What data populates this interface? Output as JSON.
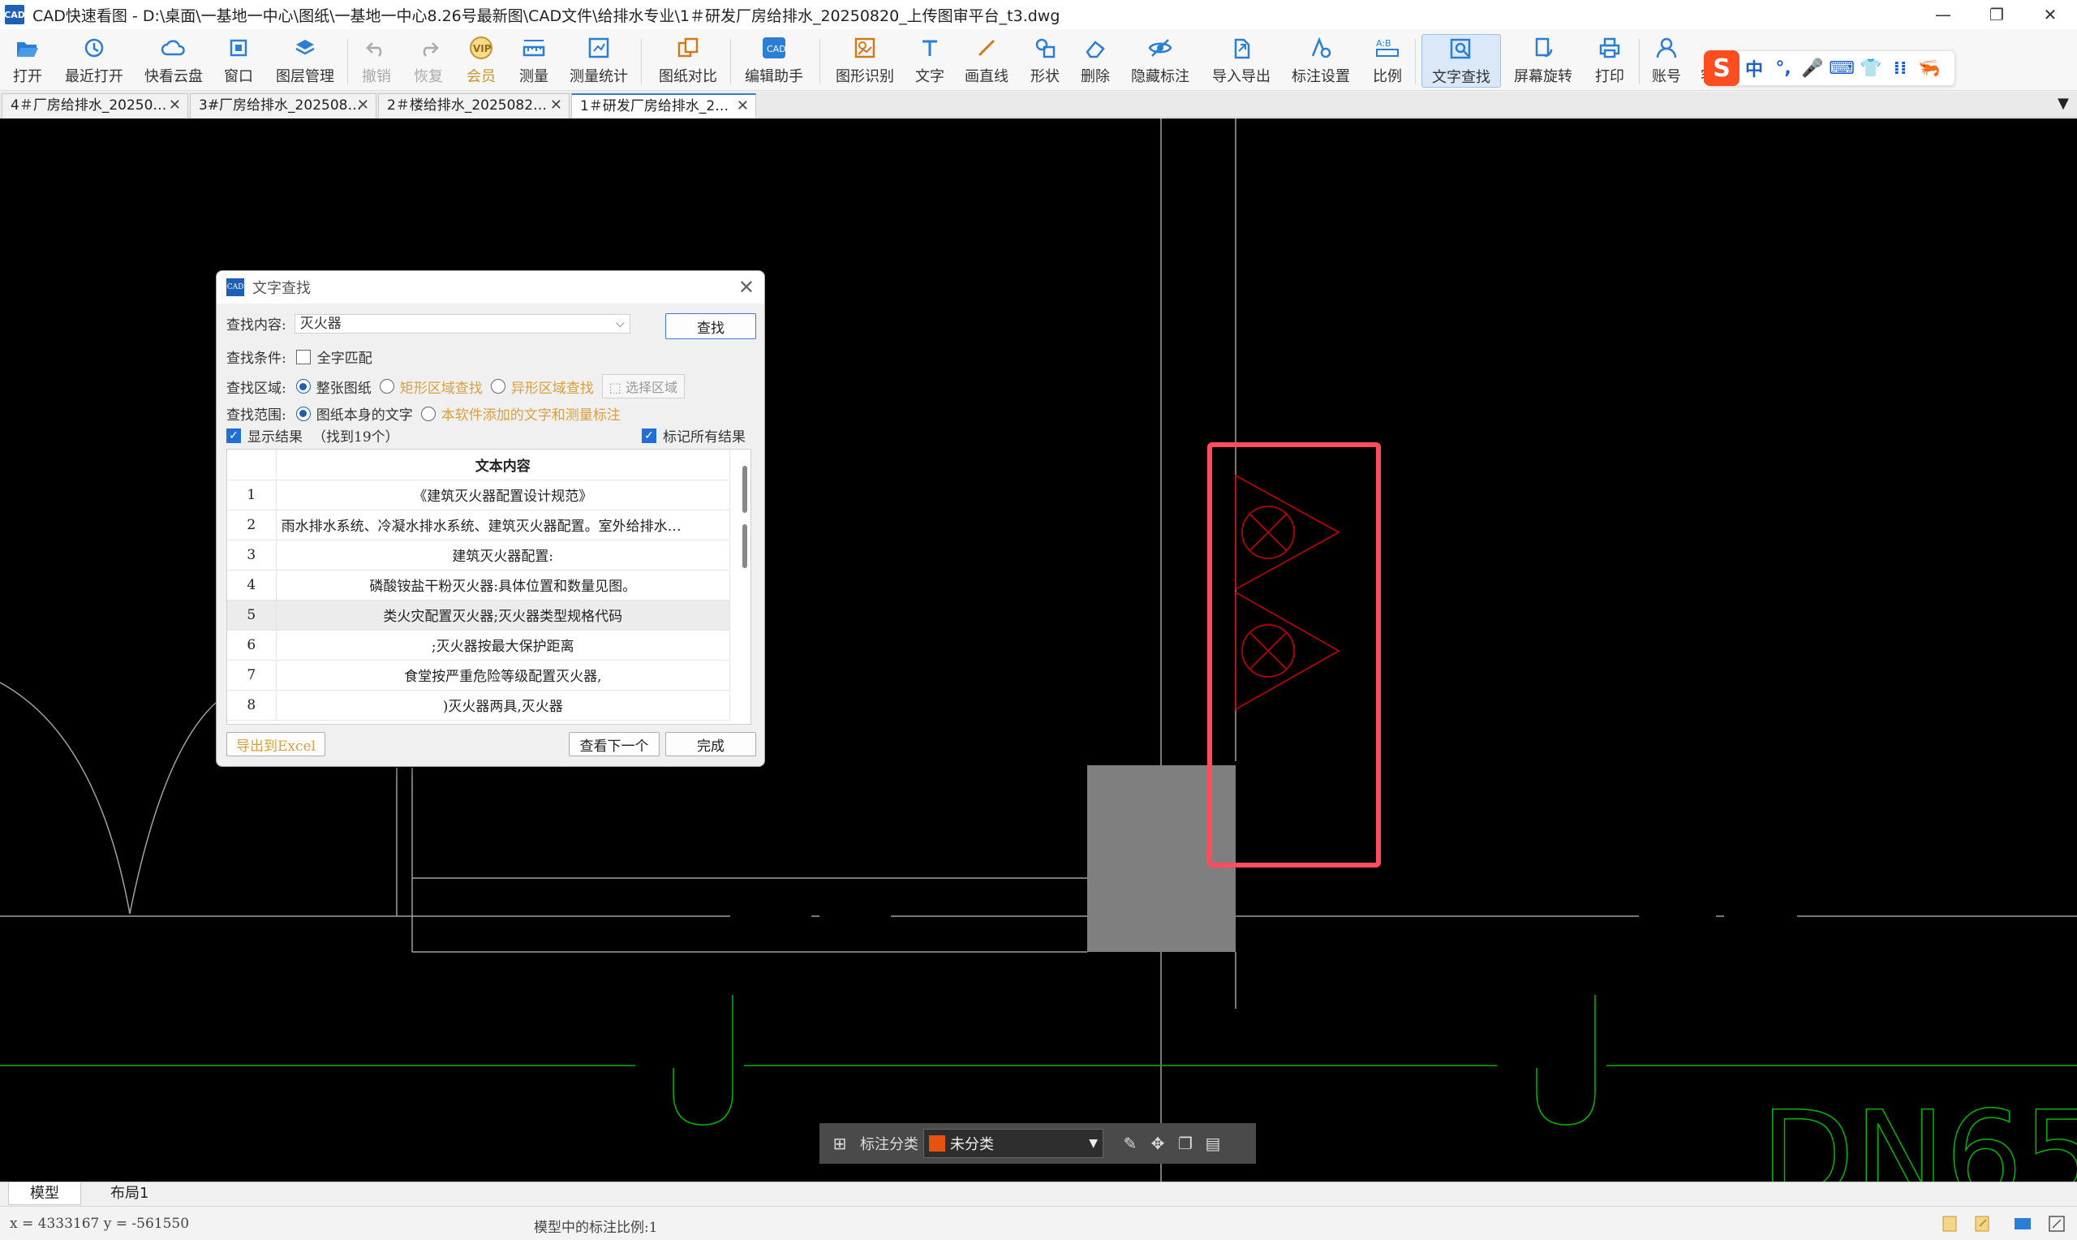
{
  "window": {
    "app_icon": "CAD",
    "title": "CAD快速看图 - D:\\桌面\\一基地一中心\\图纸\\一基地一中心8.26号最新图\\CAD文件\\给排水专业\\1＃研发厂房给排水_20250820_上传图审平台_t3.dwg",
    "minimize": "—",
    "restore": "❐",
    "close": "✕"
  },
  "toolbar": {
    "open": "打开",
    "recent": "最近打开",
    "cloud": "快看云盘",
    "window": "窗口",
    "layers": "图层管理",
    "undo": "撤销",
    "redo": "恢复",
    "vip": "会员",
    "measure": "测量",
    "measure_stats": "测量统计",
    "compare": "图纸对比",
    "edit_helper": "编辑助手",
    "shape_recog": "图形识别",
    "text": "文字",
    "line": "画直线",
    "shape": "形状",
    "delete": "删除",
    "hide_anno": "隐藏标注",
    "import_export": "导入导出",
    "anno_settings": "标注设置",
    "scale": "比例",
    "text_search": "文字查找",
    "screen_rotate": "屏幕旋转",
    "print": "打印",
    "account": "账号",
    "customer": "客"
  },
  "ime": {
    "logo": "S",
    "items": [
      "中",
      "°,",
      "🎤",
      "⌨",
      "👕",
      "⁞⁞",
      "🦐"
    ]
  },
  "tabs": [
    {
      "label": "4＃厂房给排水_20250…"
    },
    {
      "label": "3#厂房给排水_202508…"
    },
    {
      "label": "2＃楼给排水_2025082…"
    },
    {
      "label": "1＃研发厂房给排水_2…"
    }
  ],
  "tab_close": "✕",
  "tab_more": "▼",
  "dialog": {
    "icon": "CAD",
    "title": "文字查找",
    "close": "✕",
    "search_label": "查找内容:",
    "search_value": "灭火器",
    "search_button": "查找",
    "condition_label": "查找条件:",
    "whole_word": "全字匹配",
    "area_label": "查找区域:",
    "area_whole": "整张图纸",
    "area_rect": "矩形区域查找",
    "area_irregular": "异形区域查找",
    "select_area": "选择区域",
    "range_label": "查找范围:",
    "range_drawing": "图纸本身的文字",
    "range_added": "本软件添加的文字和测量标注",
    "show_results": "显示结果",
    "found_count": "（找到19个）",
    "mark_all": "标记所有结果",
    "column_header": "文本内容",
    "results": [
      {
        "n": "1",
        "text": "《建筑灭火器配置设计规范》"
      },
      {
        "n": "2",
        "text": "雨水排水系统、冷凝水排水系统、建筑灭火器配置。室外给排水…"
      },
      {
        "n": "3",
        "text": "建筑灭火器配置:"
      },
      {
        "n": "4",
        "text": "磷酸铵盐干粉灭火器:具体位置和数量见图。"
      },
      {
        "n": "5",
        "text": "类火灾配置灭火器;灭火器类型规格代码"
      },
      {
        "n": "6",
        "text": ";灭火器按最大保护距离"
      },
      {
        "n": "7",
        "text": "食堂按严重危险等级配置灭火器,"
      },
      {
        "n": "8",
        "text": ")灭火器两具,灭火器"
      }
    ],
    "export_button": "导出到Excel",
    "next_button": "查看下一个",
    "done_button": "完成"
  },
  "drawing": {
    "text_dn": "DN65",
    "highlight_color": "#ff4d5e",
    "symbol_color": "#d40000",
    "pipe_color": "#00b800"
  },
  "annobar": {
    "label": "标注分类",
    "category": "未分类",
    "arrow": "▼"
  },
  "layout_tabs": [
    "模型",
    "布局1"
  ],
  "status": {
    "coords": "x = 4333167  y = -561550",
    "scale_text": "模型中的标注比例:1"
  }
}
